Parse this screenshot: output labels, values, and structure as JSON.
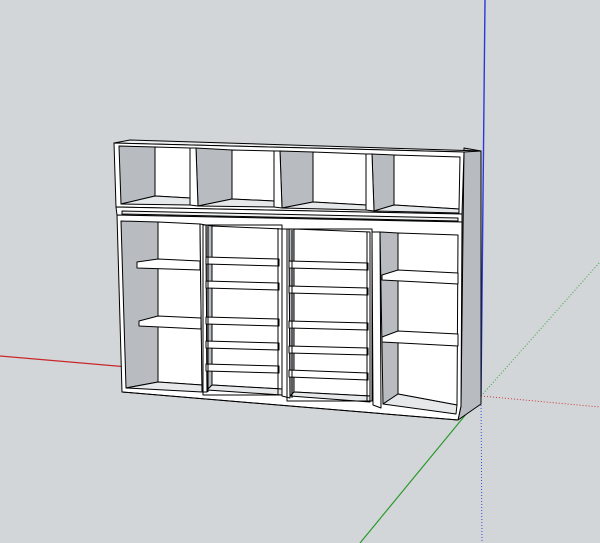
{
  "scene": {
    "background": "#d3d6d9",
    "axis_colors": {
      "red": "#c8282a",
      "green": "#2a9a2a",
      "blue": "#2a3ad8"
    },
    "model_colors": {
      "face": "#ffffff",
      "interior_back": "#ffffff",
      "side_shade": "#b8bcc0",
      "edge": "#000000"
    }
  }
}
